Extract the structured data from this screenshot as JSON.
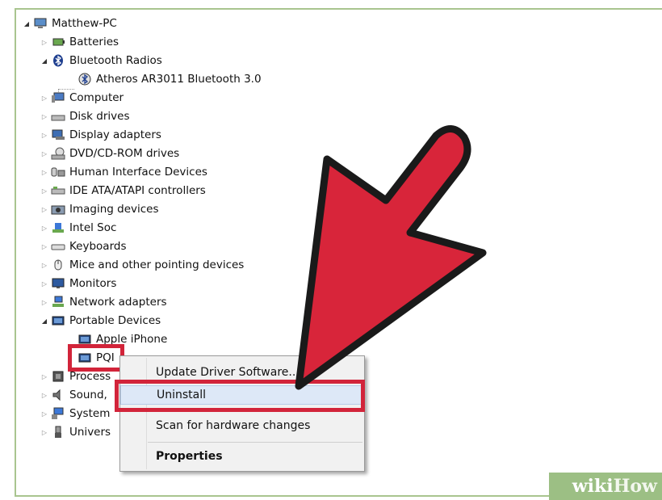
{
  "device_manager": {
    "root": {
      "label": "Matthew-PC"
    },
    "items": [
      {
        "label": "Batteries",
        "icon": "battery-icon",
        "state": "collapsed"
      },
      {
        "label": "Bluetooth Radios",
        "icon": "bluetooth-icon",
        "state": "expanded"
      },
      {
        "label": "Atheros AR3011 Bluetooth 3.0",
        "icon": "bluetooth-device-icon",
        "state": "child"
      },
      {
        "label": "Computer",
        "icon": "computer-icon",
        "state": "collapsed"
      },
      {
        "label": "Disk drives",
        "icon": "disk-drive-icon",
        "state": "collapsed"
      },
      {
        "label": "Display adapters",
        "icon": "display-adapter-icon",
        "state": "collapsed"
      },
      {
        "label": "DVD/CD-ROM drives",
        "icon": "dvd-drive-icon",
        "state": "collapsed"
      },
      {
        "label": "Human Interface Devices",
        "icon": "hid-icon",
        "state": "collapsed"
      },
      {
        "label": "IDE ATA/ATAPI controllers",
        "icon": "ide-controller-icon",
        "state": "collapsed"
      },
      {
        "label": "Imaging devices",
        "icon": "camera-icon",
        "state": "collapsed"
      },
      {
        "label": "Intel Soc",
        "icon": "chip-icon",
        "state": "collapsed"
      },
      {
        "label": "Keyboards",
        "icon": "keyboard-icon",
        "state": "collapsed"
      },
      {
        "label": "Mice and other pointing devices",
        "icon": "mouse-icon",
        "state": "collapsed"
      },
      {
        "label": "Monitors",
        "icon": "monitor-icon",
        "state": "collapsed"
      },
      {
        "label": "Network adapters",
        "icon": "network-adapter-icon",
        "state": "collapsed"
      },
      {
        "label": "Portable Devices",
        "icon": "portable-device-icon",
        "state": "expanded"
      },
      {
        "label": "Apple iPhone",
        "icon": "portable-device-icon",
        "state": "child"
      },
      {
        "label": "PQI",
        "icon": "portable-device-icon",
        "state": "child-selected"
      },
      {
        "label": "Process",
        "icon": "processor-icon",
        "state": "collapsed"
      },
      {
        "label": "Sound,",
        "icon": "speaker-icon",
        "state": "collapsed"
      },
      {
        "label": "System",
        "icon": "system-device-icon",
        "state": "collapsed"
      },
      {
        "label": "Univers",
        "icon": "usb-icon",
        "state": "collapsed"
      }
    ]
  },
  "context_menu": {
    "items": [
      {
        "label": "Update Driver Software..."
      },
      {
        "label": "Uninstall"
      },
      {
        "label": "Scan for hardware changes"
      },
      {
        "label": "Properties"
      }
    ]
  },
  "watermark": {
    "wiki": "wiki",
    "how": "How"
  },
  "colors": {
    "highlight_red": "#d2243a",
    "arrow_red": "#d8253a",
    "frame_green": "#a9c58f",
    "menu_hover": "#dde8f7"
  }
}
